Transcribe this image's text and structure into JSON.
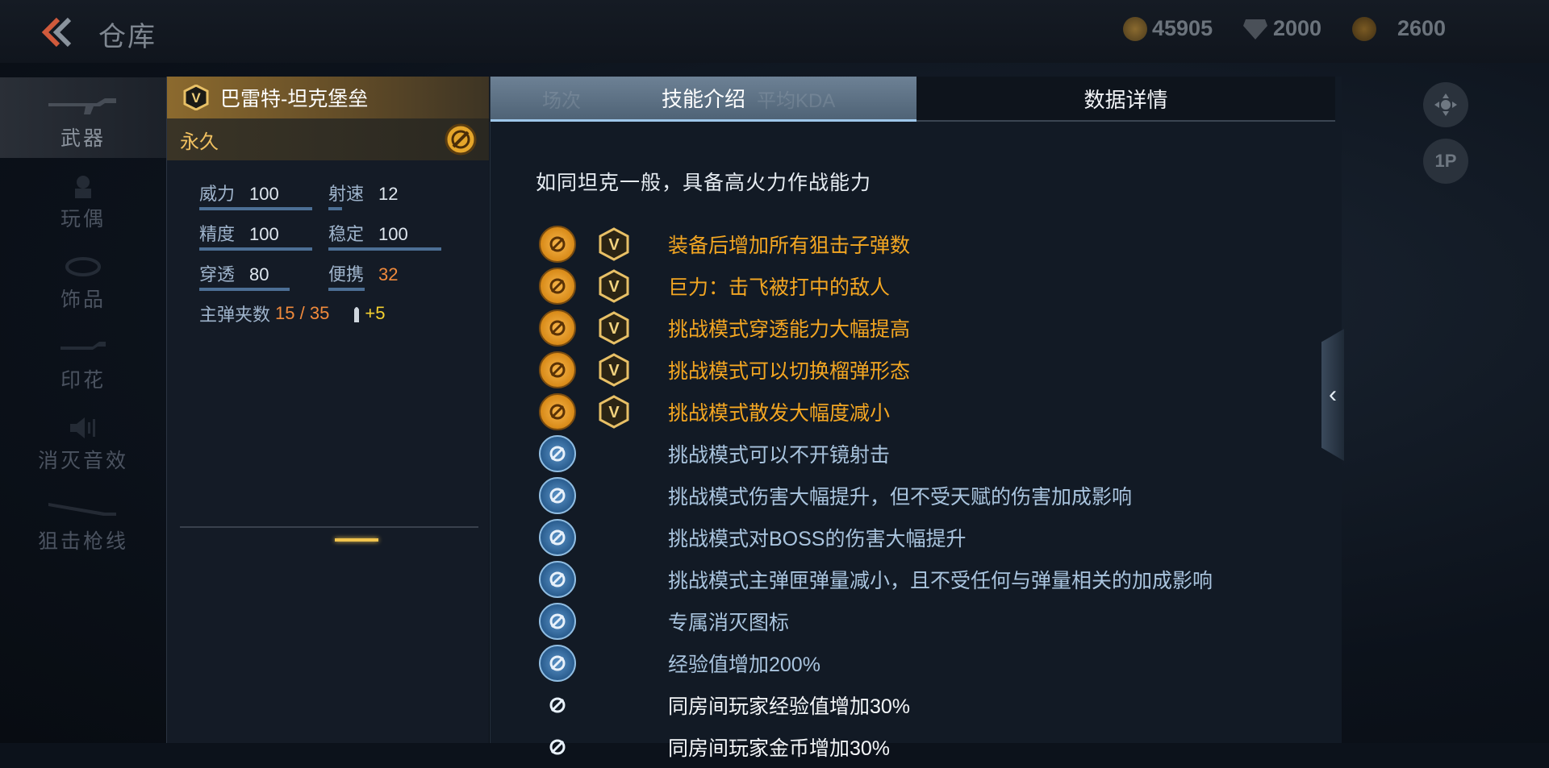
{
  "header": {
    "title": "仓库",
    "currencies": [
      {
        "icon": "gold-coin-icon",
        "value": "45905"
      },
      {
        "icon": "diamond-icon",
        "value": "2000"
      },
      {
        "icon": "honor-coin-icon",
        "value": "2600"
      }
    ]
  },
  "nav": {
    "items": [
      {
        "label": "武器",
        "icon": "rifle-icon"
      },
      {
        "label": "玩偶",
        "icon": "doll-icon"
      },
      {
        "label": "饰品",
        "icon": "accessory-icon"
      },
      {
        "label": "印花",
        "icon": "decal-icon"
      },
      {
        "label": "消灭音效",
        "icon": "sound-icon"
      },
      {
        "label": "狙击枪线",
        "icon": "sniper-line-icon"
      }
    ]
  },
  "weapon": {
    "name": "巴雷特-坦克堡垒",
    "duration": "永久",
    "stats": [
      [
        {
          "label": "威力",
          "value": "100",
          "level": 100
        },
        {
          "label": "射速",
          "value": "12",
          "level": 12
        }
      ],
      [
        {
          "label": "精度",
          "value": "100",
          "level": 100
        },
        {
          "label": "稳定",
          "value": "100",
          "level": 100
        }
      ],
      [
        {
          "label": "穿透",
          "value": "80",
          "level": 80
        },
        {
          "label": "便携",
          "value": "32",
          "level": 32
        }
      ]
    ],
    "clip_label": "主弹夹数",
    "clip_value": "15",
    "clip_sep": "/",
    "clip_max": "35",
    "ammo_bonus": "+5"
  },
  "tabs": {
    "skill": "技能介绍",
    "data": "数据详情",
    "ghost_1": "场次",
    "ghost_2": "平均KDA"
  },
  "skills": {
    "description": "如同坦克一般，具备高火力作战能力",
    "list": [
      {
        "text": "装备后增加所有狙击子弹数",
        "tier": "gold",
        "icon": "sniper-bullet-icon",
        "v_badge": true
      },
      {
        "text": "巨力：击飞被打中的敌人",
        "tier": "gold",
        "icon": "knockback-icon",
        "v_badge": true
      },
      {
        "text": "挑战模式穿透能力大幅提高",
        "tier": "gold",
        "icon": "penetration-icon",
        "v_badge": true
      },
      {
        "text": "挑战模式可以切换榴弹形态",
        "tier": "gold",
        "icon": "grenade-mode-icon",
        "v_badge": true
      },
      {
        "text": "挑战模式散发大幅度减小",
        "tier": "gold",
        "icon": "spread-icon",
        "v_badge": true
      },
      {
        "text": "挑战模式可以不开镜射击",
        "tier": "blue",
        "icon": "noscope-icon",
        "v_badge": false
      },
      {
        "text": "挑战模式伤害大幅提升，但不受天赋的伤害加成影响",
        "tier": "blue",
        "icon": "damage-up-icon",
        "v_badge": false
      },
      {
        "text": "挑战模式对BOSS的伤害大幅提升",
        "tier": "blue",
        "icon": "boss-damage-icon",
        "v_badge": false
      },
      {
        "text": "挑战模式主弹匣弹量减小，且不受任何与弹量相关的加成影响",
        "tier": "blue",
        "icon": "magazine-icon",
        "v_badge": false
      },
      {
        "text": "专属消灭图标",
        "tier": "blue",
        "icon": "kill-icon",
        "v_badge": false
      },
      {
        "text": "经验值增加200%",
        "tier": "blue",
        "icon": "exp-icon",
        "v_badge": false
      },
      {
        "text": "同房间玩家经验值增加30%",
        "tier": "white",
        "icon": "room-exp-icon",
        "v_badge": false
      },
      {
        "text": "同房间玩家金币增加30%",
        "tier": "white",
        "icon": "room-coin-icon",
        "v_badge": false
      }
    ]
  },
  "colors": {
    "gold_text": "#f3a622",
    "blue_text": "#a9c4de",
    "accent": "#f1c44d"
  }
}
